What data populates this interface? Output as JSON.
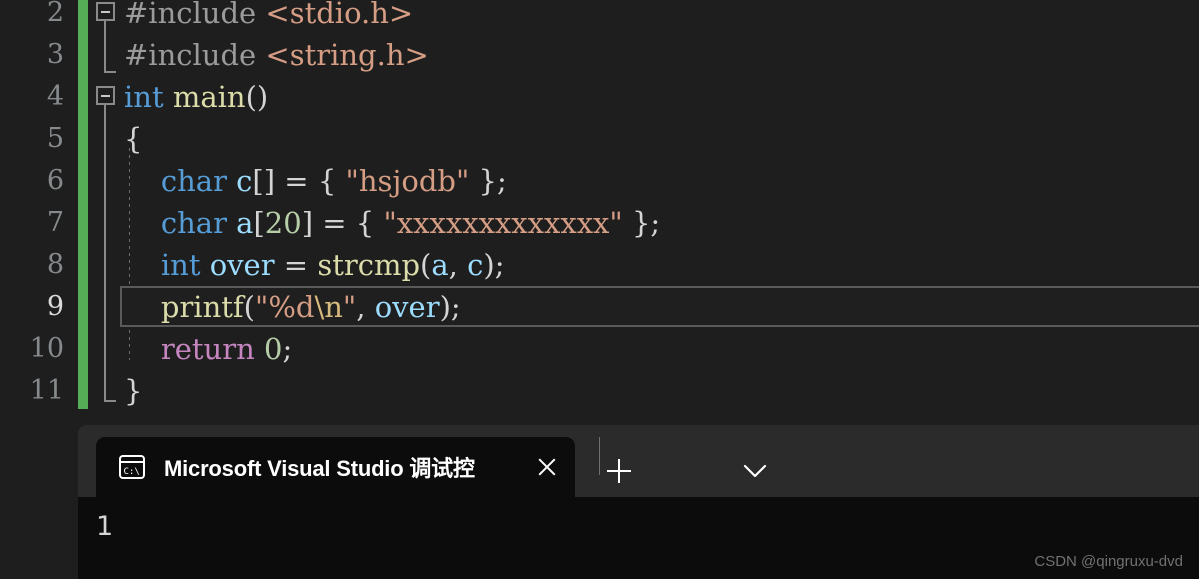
{
  "app": {
    "kind": "visual-studio-code-editor-with-terminal",
    "theme": "dark"
  },
  "editor": {
    "background": "#1e1e1e",
    "change_bar_color": "#55ad55",
    "active_line_number": "9",
    "line_numbers": [
      "2",
      "3",
      "4",
      "5",
      "6",
      "7",
      "8",
      "9",
      "10",
      "11"
    ],
    "lines": [
      {
        "num": "2",
        "text": "#include <stdio.h>"
      },
      {
        "num": "3",
        "text": "#include <string.h>"
      },
      {
        "num": "4",
        "text": "int main()"
      },
      {
        "num": "5",
        "text": "{"
      },
      {
        "num": "6",
        "text": "    char c[] = { \"hsjodb\" };"
      },
      {
        "num": "7",
        "text": "    char a[20] = { \"xxxxxxxxxxxxx\" };"
      },
      {
        "num": "8",
        "text": "    int over = strcmp(a, c);"
      },
      {
        "num": "9",
        "text": "    printf(\"%d\\n\", over);"
      },
      {
        "num": "10",
        "text": "    return 0;"
      },
      {
        "num": "11",
        "text": "}"
      }
    ],
    "tokens": {
      "include_2": "#include",
      "header_2": "<stdio.h>",
      "include_3": "#include",
      "header_3": "<string.h>",
      "kw_int_4": "int",
      "fn_main_4": "main",
      "paren_4": "()",
      "brace_open_5": "{",
      "kw_char_6": "char",
      "var_c_6": "c",
      "brackets_6": "[]",
      "eq_6": " = ",
      "brace_6a": "{ ",
      "str_6": "\"hsjodb\"",
      "brace_6b": " }",
      "semi_6": ";",
      "kw_char_7": "char",
      "var_a_7": "a",
      "bracket_open_7": "[",
      "num_20_7": "20",
      "bracket_close_7": "]",
      "eq_7": " = ",
      "brace_7a": "{ ",
      "str_7": "\"xxxxxxxxxxxxx\"",
      "brace_7b": " }",
      "semi_7": ";",
      "kw_int_8": "int",
      "var_over_8": "over",
      "eq_8": " = ",
      "fn_strcmp_8": "strcmp",
      "paren_8a": "(",
      "var_a_8": "a",
      "comma_8": ", ",
      "var_c_8": "c",
      "paren_8b": ")",
      "semi_8": ";",
      "fn_printf_9": "printf",
      "paren_9a": "(",
      "str_9a": "\"%d",
      "esc_9": "\\n",
      "str_9b": "\"",
      "comma_9": ", ",
      "var_over_9": "over",
      "paren_9b": ")",
      "semi_9": ";",
      "kw_return_10": "return",
      "num_zero_10": "0",
      "semi_10": ";",
      "brace_close_11": "}"
    },
    "fold_markers": [
      "collapse-line-2",
      "collapse-line-4"
    ]
  },
  "terminal": {
    "tab": {
      "title": "Microsoft Visual Studio 调试控",
      "icon": "console-cmd-icon",
      "close_label": "close-icon"
    },
    "new_tab_label": "new-tab-icon",
    "dropdown_label": "chevron-down-icon",
    "output": "1",
    "background": "#0c0c0c",
    "tabbar_background": "#2b2b2b"
  },
  "watermark": {
    "text": "CSDN @qingruxu-dvd"
  }
}
